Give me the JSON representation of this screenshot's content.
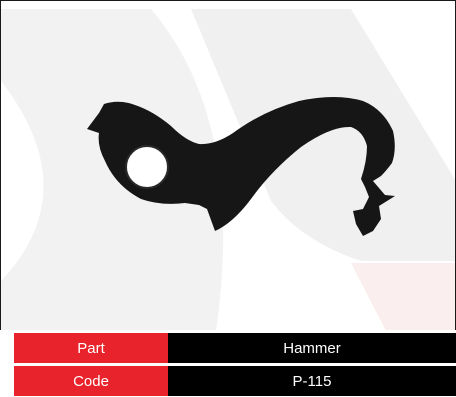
{
  "colors": {
    "label_bg": "#e8232b",
    "value_bg": "#000000",
    "watermark": "#f1f1f1",
    "watermark_accent": "#fbeeee",
    "part_fill": "#161616"
  },
  "product": {
    "image_icon": "hammer-part-image"
  },
  "specs": [
    {
      "label": "Part",
      "value": "Hammer"
    },
    {
      "label": "Code",
      "value": "P-115"
    }
  ]
}
